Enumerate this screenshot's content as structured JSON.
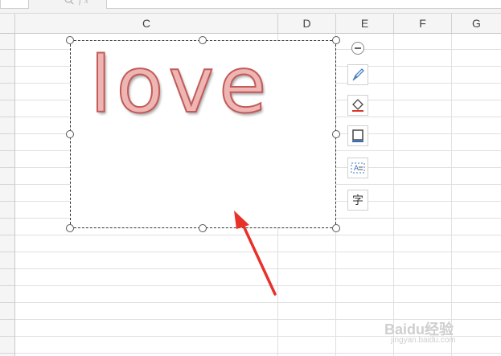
{
  "columns": [
    {
      "label": "C"
    },
    {
      "label": "D"
    },
    {
      "label": "E"
    },
    {
      "label": "F"
    },
    {
      "label": "G"
    }
  ],
  "wordart": {
    "text": "love"
  },
  "toolbar": {
    "items": [
      "collapse",
      "brush-icon",
      "fill-icon",
      "outline-icon",
      "text-box-icon",
      "text-wrap-icon"
    ],
    "text_wrap_glyph": "字"
  },
  "arrow_color": "#e8312a",
  "watermark": {
    "brand": "Baidu经验",
    "url": "jingyan.baidu.com"
  }
}
